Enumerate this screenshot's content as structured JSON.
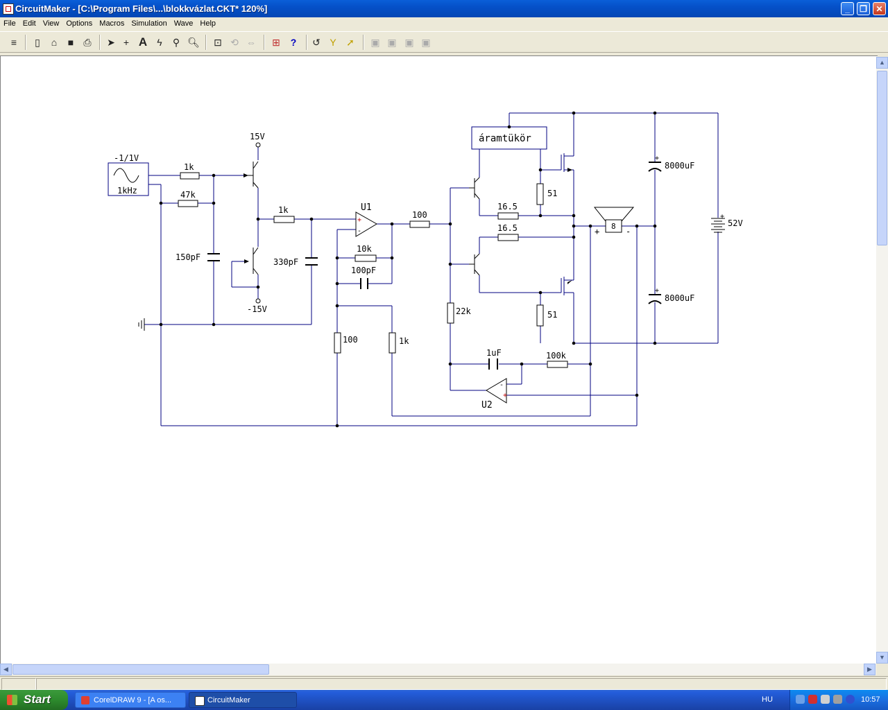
{
  "window": {
    "title": "CircuitMaker - [C:\\Program Files\\...\\blokkvázlat.CKT* 120%]"
  },
  "window_controls": {
    "minimize": "_",
    "restore": "❐",
    "close": "✕"
  },
  "menu": [
    "File",
    "Edit",
    "View",
    "Options",
    "Macros",
    "Simulation",
    "Wave",
    "Help"
  ],
  "schematic": {
    "labels": {
      "source_amp": "-1/1V",
      "source_freq": "1kHz",
      "r_in": "1k",
      "r_47k": "47k",
      "c_150p": "150pF",
      "vplus": "15V",
      "vminus": "-15V",
      "r_1k_mid": "1k",
      "c_330p": "330pF",
      "u1": "U1",
      "r_10k": "10k",
      "c_100p": "100pF",
      "r_100_top": "100",
      "r_100_left": "100",
      "r_1k_fb": "1k",
      "mirror": "áramtükör",
      "r_16_5_a": "16.5",
      "r_16_5_b": "16.5",
      "r_51_a": "51",
      "r_51_b": "51",
      "r_22k": "22k",
      "c_1u": "1uF",
      "r_100k": "100k",
      "u2": "U2",
      "speaker": "8",
      "c_8000_top": "8000uF",
      "c_8000_bot": "8000uF",
      "battery": "52V"
    }
  },
  "taskbar": {
    "start": "Start",
    "tasks": [
      "CorelDRAW 9 - [A os...",
      "CircuitMaker"
    ],
    "language": "HU",
    "clock": "10:57"
  },
  "colors": {
    "wire": "#000080",
    "titlebar": "#0550c8",
    "taskbar": "#245edb"
  }
}
